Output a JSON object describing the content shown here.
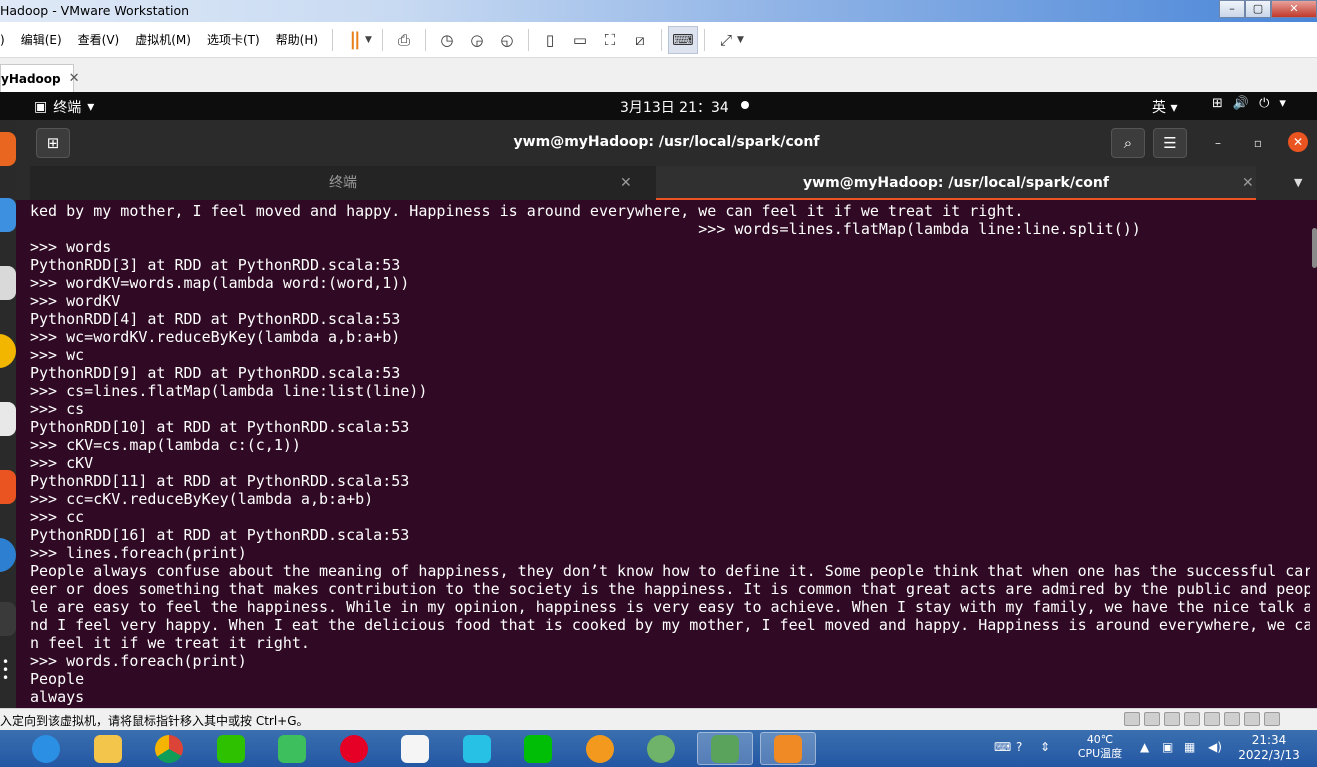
{
  "window": {
    "title": "Hadoop - VMware Workstation",
    "controls": [
      "–",
      "▢",
      "✕"
    ]
  },
  "menubar": {
    "items": [
      "编辑(E)",
      "查看(V)",
      "虚拟机(M)",
      "选项卡(T)",
      "帮助(H)"
    ],
    "first_fragment": ")"
  },
  "vm_tab": {
    "label": "yHadoop",
    "close": "✕"
  },
  "gnome": {
    "activities": "终端",
    "activities_arrow": "▾",
    "clock": "3月13日  21：34",
    "lang": "英 ▾",
    "sys_icons": [
      "⊞",
      "🔊",
      "⏻",
      "▾"
    ]
  },
  "terminal": {
    "title": "ywm@myHadoop: /usr/local/spark/conf",
    "tabs": [
      {
        "label": "终端",
        "close": "✕"
      },
      {
        "label": "ywm@myHadoop: /usr/local/spark/conf",
        "close": "✕"
      }
    ],
    "lines": [
      "ked by my mother, I feel moved and happy. Happiness is around everywhere, we can feel it if we treat it right.",
      "                                                                          >>> words=lines.flatMap(lambda line:line.split())",
      ">>> words",
      "PythonRDD[3] at RDD at PythonRDD.scala:53",
      ">>> wordKV=words.map(lambda word:(word,1))",
      ">>> wordKV",
      "PythonRDD[4] at RDD at PythonRDD.scala:53",
      ">>> wc=wordKV.reduceByKey(lambda a,b:a+b)",
      ">>> wc",
      "PythonRDD[9] at RDD at PythonRDD.scala:53",
      ">>> cs=lines.flatMap(lambda line:list(line))",
      ">>> cs",
      "PythonRDD[10] at RDD at PythonRDD.scala:53",
      ">>> cKV=cs.map(lambda c:(c,1))",
      ">>> cKV",
      "PythonRDD[11] at RDD at PythonRDD.scala:53",
      ">>> cc=cKV.reduceByKey(lambda a,b:a+b)",
      ">>> cc",
      "PythonRDD[16] at RDD at PythonRDD.scala:53",
      ">>> lines.foreach(print)",
      "People always confuse about the meaning of happiness, they don’t know how to define it. Some people think that when one has the successful car",
      "eer or does something that makes contribution to the society is the happiness. It is common that great acts are admired by the public and peop",
      "le are easy to feel the happiness. While in my opinion, happiness is very easy to achieve. When I stay with my family, we have the nice talk a",
      "nd I feel very happy. When I eat the delicious food that is cooked by my mother, I feel moved and happy. Happiness is around everywhere, we ca",
      "n feel it if we treat it right.",
      ">>> words.foreach(print)",
      "People",
      "always"
    ]
  },
  "statusbar": {
    "message": "入定向到该虚拟机，请将鼠标指针移入其中或按 Ctrl+G。"
  },
  "taskbar": {
    "tray": {
      "temp_value": "40℃",
      "temp_label": "CPU温度",
      "time": "21:34",
      "date": "2022/3/13"
    }
  }
}
